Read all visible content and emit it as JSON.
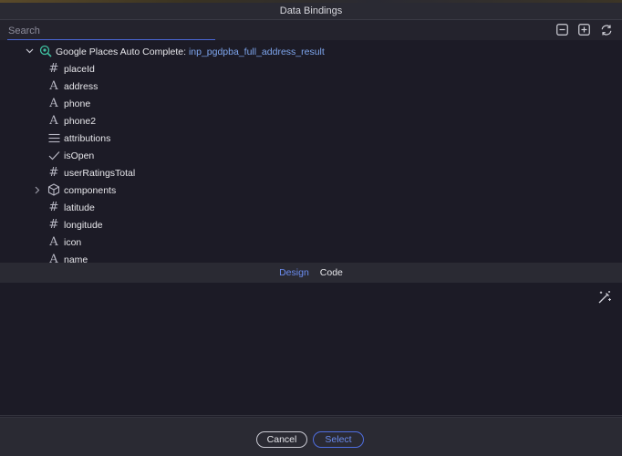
{
  "window": {
    "title": "Data Bindings"
  },
  "search": {
    "placeholder": "Search",
    "value": ""
  },
  "toolbar": {
    "collapse_icon": "minus-box-icon",
    "expand_icon": "plus-box-icon",
    "refresh_icon": "refresh-icon"
  },
  "tree": {
    "root": {
      "label": "Google Places Auto Complete:",
      "variable": "inp_pgdpba_full_address_result",
      "icon": "search-data-icon",
      "expanded": true
    },
    "items": [
      {
        "label": "placeId",
        "type": "number"
      },
      {
        "label": "address",
        "type": "text"
      },
      {
        "label": "phone",
        "type": "text"
      },
      {
        "label": "phone2",
        "type": "text"
      },
      {
        "label": "attributions",
        "type": "list"
      },
      {
        "label": "isOpen",
        "type": "boolean"
      },
      {
        "label": "userRatingsTotal",
        "type": "number"
      },
      {
        "label": "components",
        "type": "object",
        "expandable": true
      },
      {
        "label": "latitude",
        "type": "number"
      },
      {
        "label": "longitude",
        "type": "number"
      },
      {
        "label": "icon",
        "type": "text"
      },
      {
        "label": "name",
        "type": "text"
      }
    ]
  },
  "tabs": {
    "design": "Design",
    "code": "Code",
    "active": "design"
  },
  "footer": {
    "cancel_label": "Cancel",
    "select_label": "Select"
  },
  "colors": {
    "accent": "#6b8cf0",
    "variable": "#7ea6ee",
    "background": "#1c1b26"
  }
}
